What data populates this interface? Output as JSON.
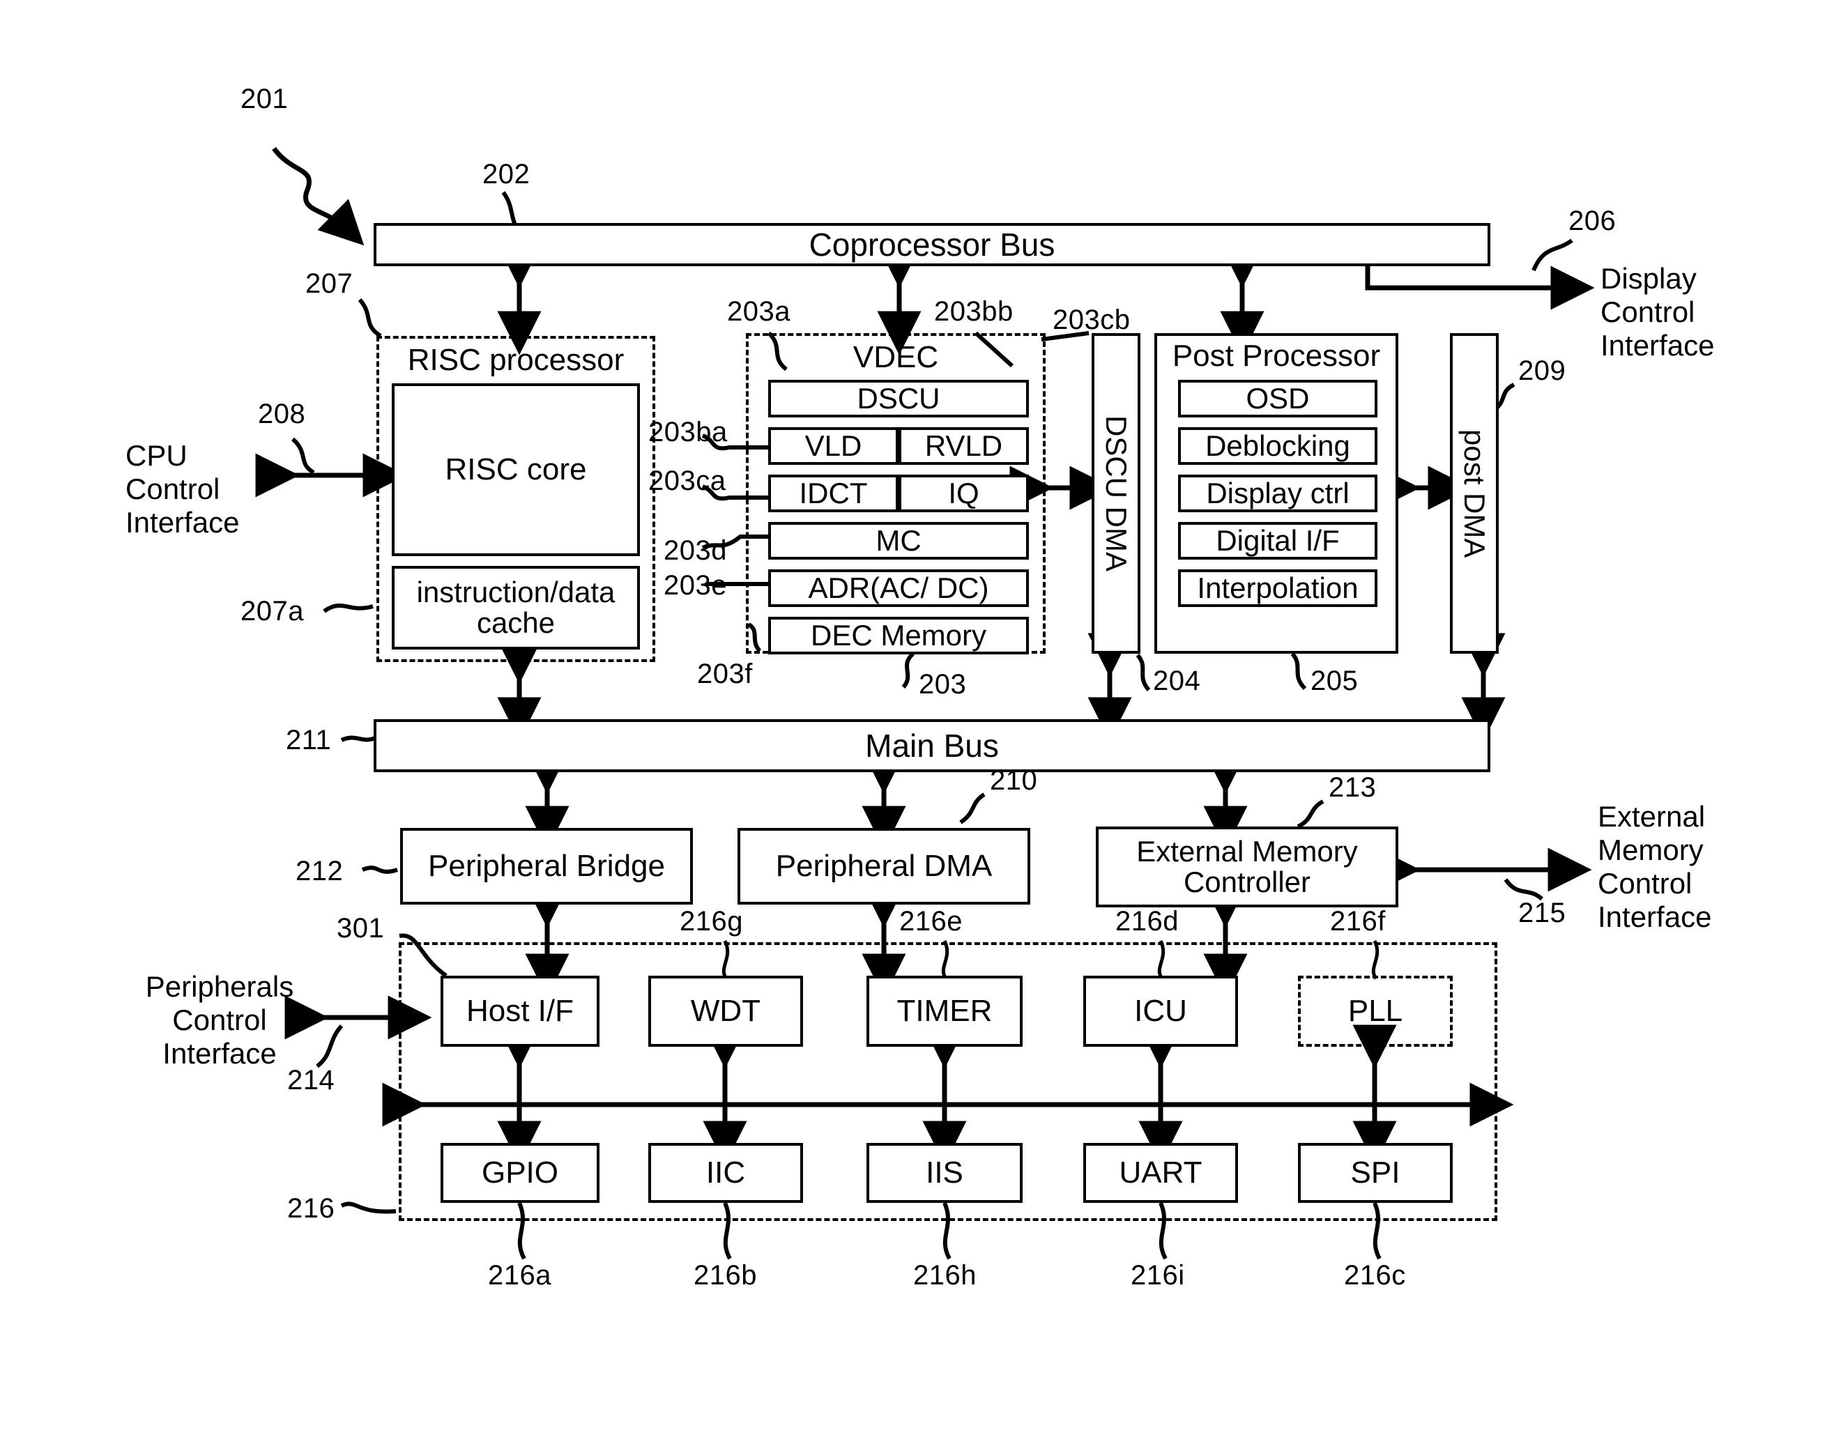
{
  "figure": {
    "ref_main": "201",
    "buses": {
      "coprocessor": {
        "label": "Coprocessor Bus",
        "ref": "202"
      },
      "main": {
        "label": "Main Bus",
        "ref": "211"
      }
    },
    "risc": {
      "title": "RISC processor",
      "ref": "207",
      "core": {
        "label": "RISC core"
      },
      "cache": {
        "label": "instruction/data\ncache",
        "ref": "207a"
      }
    },
    "vdec": {
      "title": "VDEC",
      "ref": "203",
      "ref_title": "203a",
      "blocks": [
        {
          "label": "DSCU",
          "ref": "203bb"
        },
        {
          "label": "VLD",
          "ref": "203ba"
        },
        {
          "label": "RVLD",
          "ref": ""
        },
        {
          "label": "IDCT",
          "ref": "203ca"
        },
        {
          "label": "IQ",
          "ref": ""
        },
        {
          "label": "MC",
          "ref": "203d"
        },
        {
          "label": "ADR(AC/ DC)",
          "ref": "203e"
        },
        {
          "label": "DEC Memory",
          "ref": "203f"
        }
      ]
    },
    "dscu_dma": {
      "label": "DSCU DMA",
      "ref": "204",
      "ref_top": "203cb"
    },
    "post_processor": {
      "title": "Post Processor",
      "ref": "205",
      "blocks": [
        {
          "label": "OSD"
        },
        {
          "label": "Deblocking"
        },
        {
          "label": "Display ctrl"
        },
        {
          "label": "Digital I/F"
        },
        {
          "label": "Interpolation"
        }
      ]
    },
    "post_dma": {
      "label": "post DMA",
      "ref": "209"
    },
    "interfaces": {
      "cpu": {
        "label": "CPU\nControl\nInterface",
        "ref": "208"
      },
      "display": {
        "label": "Display\nControl\nInterface",
        "ref": "206"
      },
      "external_memory": {
        "label": "External\nMemory\nControl\nInterface",
        "ref": "215"
      },
      "peripherals": {
        "label": "Peripherals\nControl\nInterface",
        "ref": "214"
      }
    },
    "mid_row": [
      {
        "label": "Peripheral Bridge",
        "ref": "212"
      },
      {
        "label": "Peripheral DMA",
        "ref": "210"
      },
      {
        "label": "External Memory\nController",
        "ref": "213"
      }
    ],
    "peripherals": {
      "ref": "216",
      "ref_host": "301",
      "row_top": [
        {
          "label": "Host I/F",
          "ref": "",
          "dashed": false
        },
        {
          "label": "WDT",
          "ref": "216g",
          "dashed": false
        },
        {
          "label": "TIMER",
          "ref": "216e",
          "dashed": false
        },
        {
          "label": "ICU",
          "ref": "216d",
          "dashed": false
        },
        {
          "label": "PLL",
          "ref": "216f",
          "dashed": true
        }
      ],
      "row_bottom": [
        {
          "label": "GPIO",
          "ref": "216a"
        },
        {
          "label": "IIC",
          "ref": "216b"
        },
        {
          "label": "IIS",
          "ref": "216h"
        },
        {
          "label": "UART",
          "ref": "216i"
        },
        {
          "label": "SPI",
          "ref": "216c"
        }
      ]
    }
  }
}
